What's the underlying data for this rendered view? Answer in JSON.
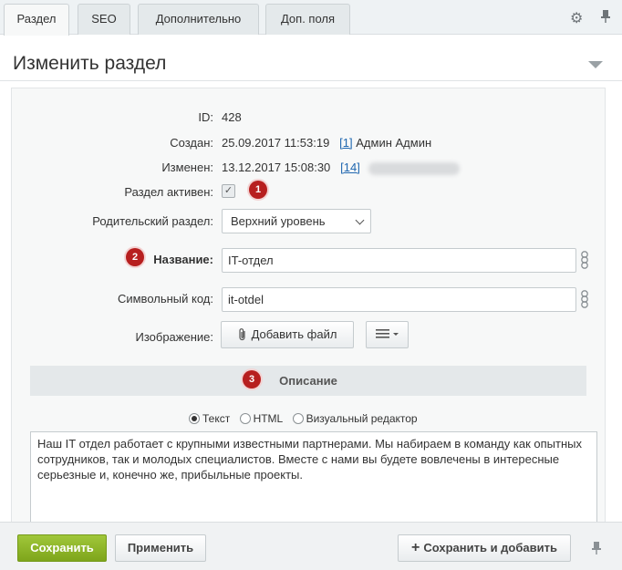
{
  "tabs": [
    {
      "label": "Раздел",
      "active": true
    },
    {
      "label": "SEO"
    },
    {
      "label": "Дополнительно"
    },
    {
      "label": "Доп. поля"
    }
  ],
  "header": {
    "title": "Изменить раздел"
  },
  "fields": {
    "id_label": "ID:",
    "id_value": "428",
    "created_label": "Создан:",
    "created_date": "25.09.2017 11:53:19",
    "created_user_link": "[1]",
    "created_user_name": "Админ Админ",
    "modified_label": "Изменен:",
    "modified_date": "13.12.2017 15:08:30",
    "modified_user_link": "[14]",
    "active_label": "Раздел активен:",
    "parent_label": "Родительский раздел:",
    "parent_value": "Верхний уровень",
    "name_label": "Название:",
    "name_value": "IT-отдел",
    "code_label": "Символьный код:",
    "code_value": "it-otdel",
    "image_label": "Изображение:",
    "add_file_label": "Добавить файл"
  },
  "badges": [
    "1",
    "2",
    "3"
  ],
  "description": {
    "section_title": "Описание",
    "modes": [
      "Текст",
      "HTML",
      "Визуальный редактор"
    ],
    "selected_mode": "Текст",
    "text": "Наш IT отдел работает с крупными известными партнерами. Мы набираем в команду как опытных сотрудников, так и молодых специалистов. Вместе с нами вы будете вовлечены в интересные серьезные и, конечно же, прибыльные проекты."
  },
  "footer": {
    "save_label": "Сохранить",
    "apply_label": "Применить",
    "save_add_label": "Сохранить и добавить"
  },
  "colors": {
    "accent_green": "#8db42a",
    "badge_red": "#b71f1f",
    "link": "#2067b0"
  },
  "icons": [
    "gear-icon",
    "pin-icon",
    "chevron-down-icon",
    "paperclip-icon",
    "menu-icon",
    "chain-link-icon",
    "plus-icon"
  ]
}
